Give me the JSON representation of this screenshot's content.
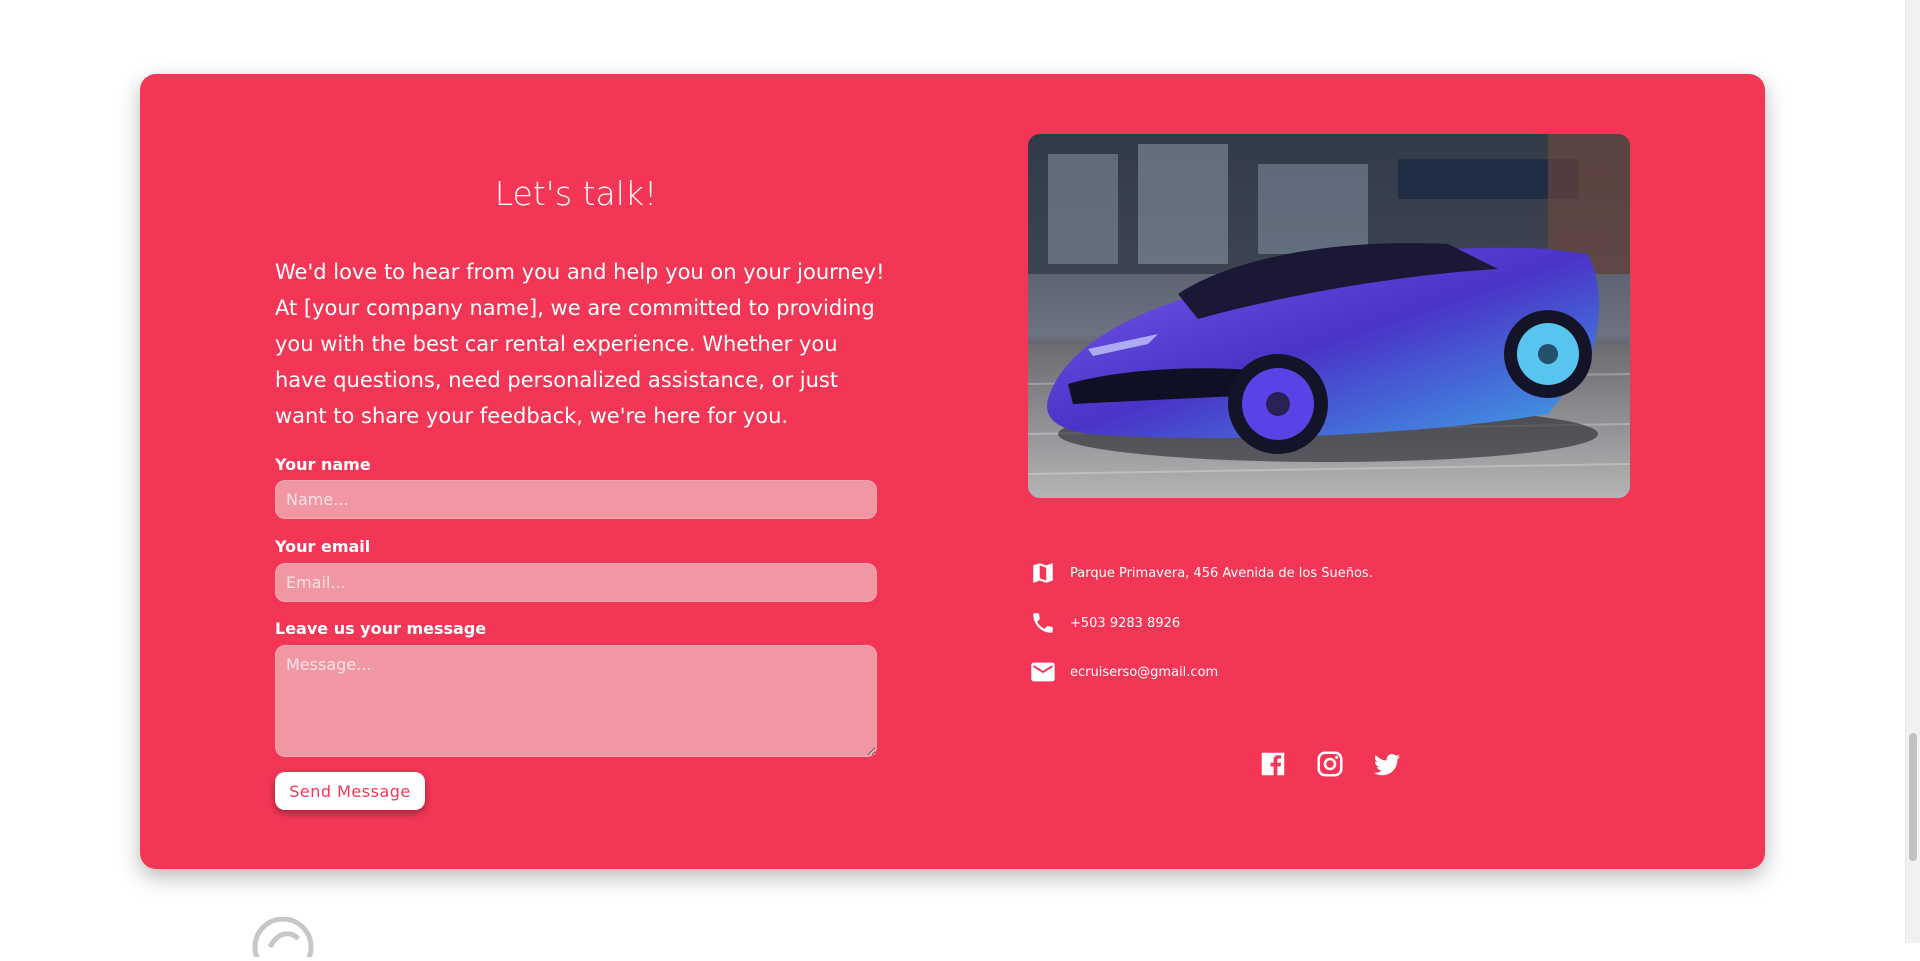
{
  "contact": {
    "heading": "Let's talk!",
    "intro": "We'd love to hear from you and help you on your journey! At [your company name], we are committed to providing you with the best car rental experience. Whether you have questions, need personalized assistance, or just want to share your feedback, we're here for you.",
    "form": {
      "name_label": "Your name",
      "name_placeholder": "Name...",
      "email_label": "Your email",
      "email_placeholder": "Email...",
      "message_label": "Leave us your message",
      "message_placeholder": "Message...",
      "send_label": "Send Message"
    },
    "info": {
      "address": "Parque Primavera, 456 Avenida de los Sueños.",
      "phone": "+503 9283 8926",
      "email": "ecruiserso@gmail.com"
    },
    "social": [
      "facebook-icon",
      "instagram-icon",
      "twitter-icon"
    ]
  },
  "colors": {
    "card": "#f33656",
    "field": "#f197a3",
    "car": "#5b3fe0"
  }
}
